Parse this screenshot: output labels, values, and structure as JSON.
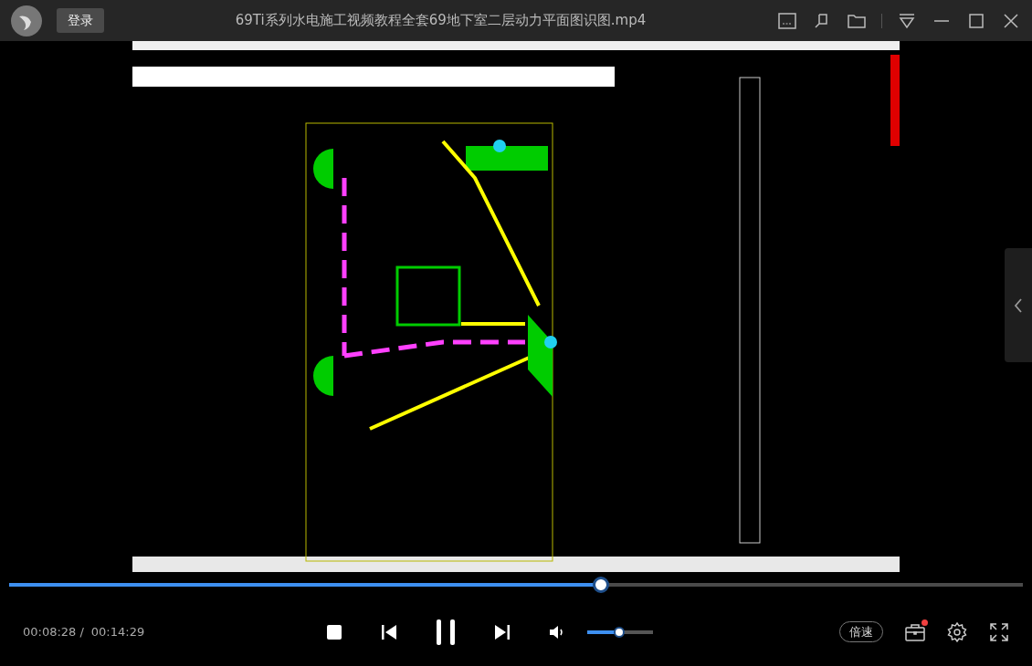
{
  "title_bar": {
    "login_button": "登录",
    "title": "69Ti系列水电施工视频教程全套69地下室二层动力平面图识图.mp4"
  },
  "progress": {
    "level": 0.584
  },
  "controls": {
    "current_time": "00:08:28",
    "separator": "/",
    "total_time": "00:14:29",
    "playing": true,
    "volume": {
      "level": 0.49
    },
    "speed_button": "倍速",
    "toolbox_notification": true
  }
}
